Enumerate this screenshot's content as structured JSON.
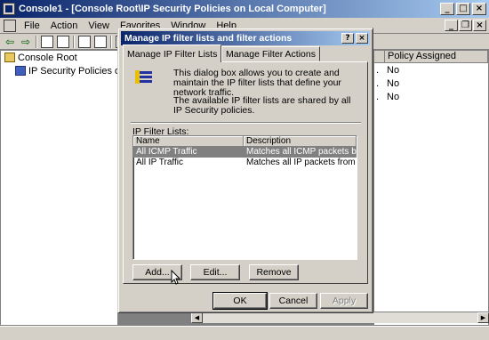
{
  "window": {
    "title": "Console1 - [Console Root\\IP Security Policies on Local Computer]",
    "min_glyph": "_",
    "max_glyph": "□",
    "close_glyph": "×"
  },
  "menubar": {
    "items": [
      "File",
      "Action",
      "View",
      "Favorites",
      "Window",
      "Help"
    ],
    "mdi_min": "_",
    "mdi_restore": "❐",
    "mdi_close": "×"
  },
  "toolbar": {
    "back_glyph": "⇦",
    "forward_glyph": "⇨"
  },
  "tree": {
    "root": "Console Root",
    "child": "IP Security Policies on Local C"
  },
  "rightpane": {
    "column_header": "Policy Assigned",
    "rows": [
      {
        "dot": ".",
        "value": "No"
      },
      {
        "dot": ".",
        "value": "No"
      },
      {
        "dot": ".",
        "value": "No"
      }
    ]
  },
  "dialog": {
    "title": "Manage IP filter lists and filter actions",
    "help_glyph": "?",
    "close_glyph": "×",
    "tabs": [
      "Manage IP Filter Lists",
      "Manage Filter Actions"
    ],
    "intro_1": "This dialog box allows you to create and maintain the IP filter lists that define your network traffic.",
    "intro_2": "The available IP filter lists are shared by all IP Security policies.",
    "group_label": "IP Filter Lists:",
    "list": {
      "columns": [
        "Name",
        "Description"
      ],
      "rows": [
        {
          "name": "All ICMP Traffic",
          "description": "Matches all ICMP packets betw..."
        },
        {
          "name": "All IP Traffic",
          "description": "Matches all IP packets from this ..."
        }
      ]
    },
    "buttons": {
      "add": "Add...",
      "edit": "Edit...",
      "remove": "Remove",
      "ok": "OK",
      "cancel": "Cancel",
      "apply": "Apply"
    }
  }
}
